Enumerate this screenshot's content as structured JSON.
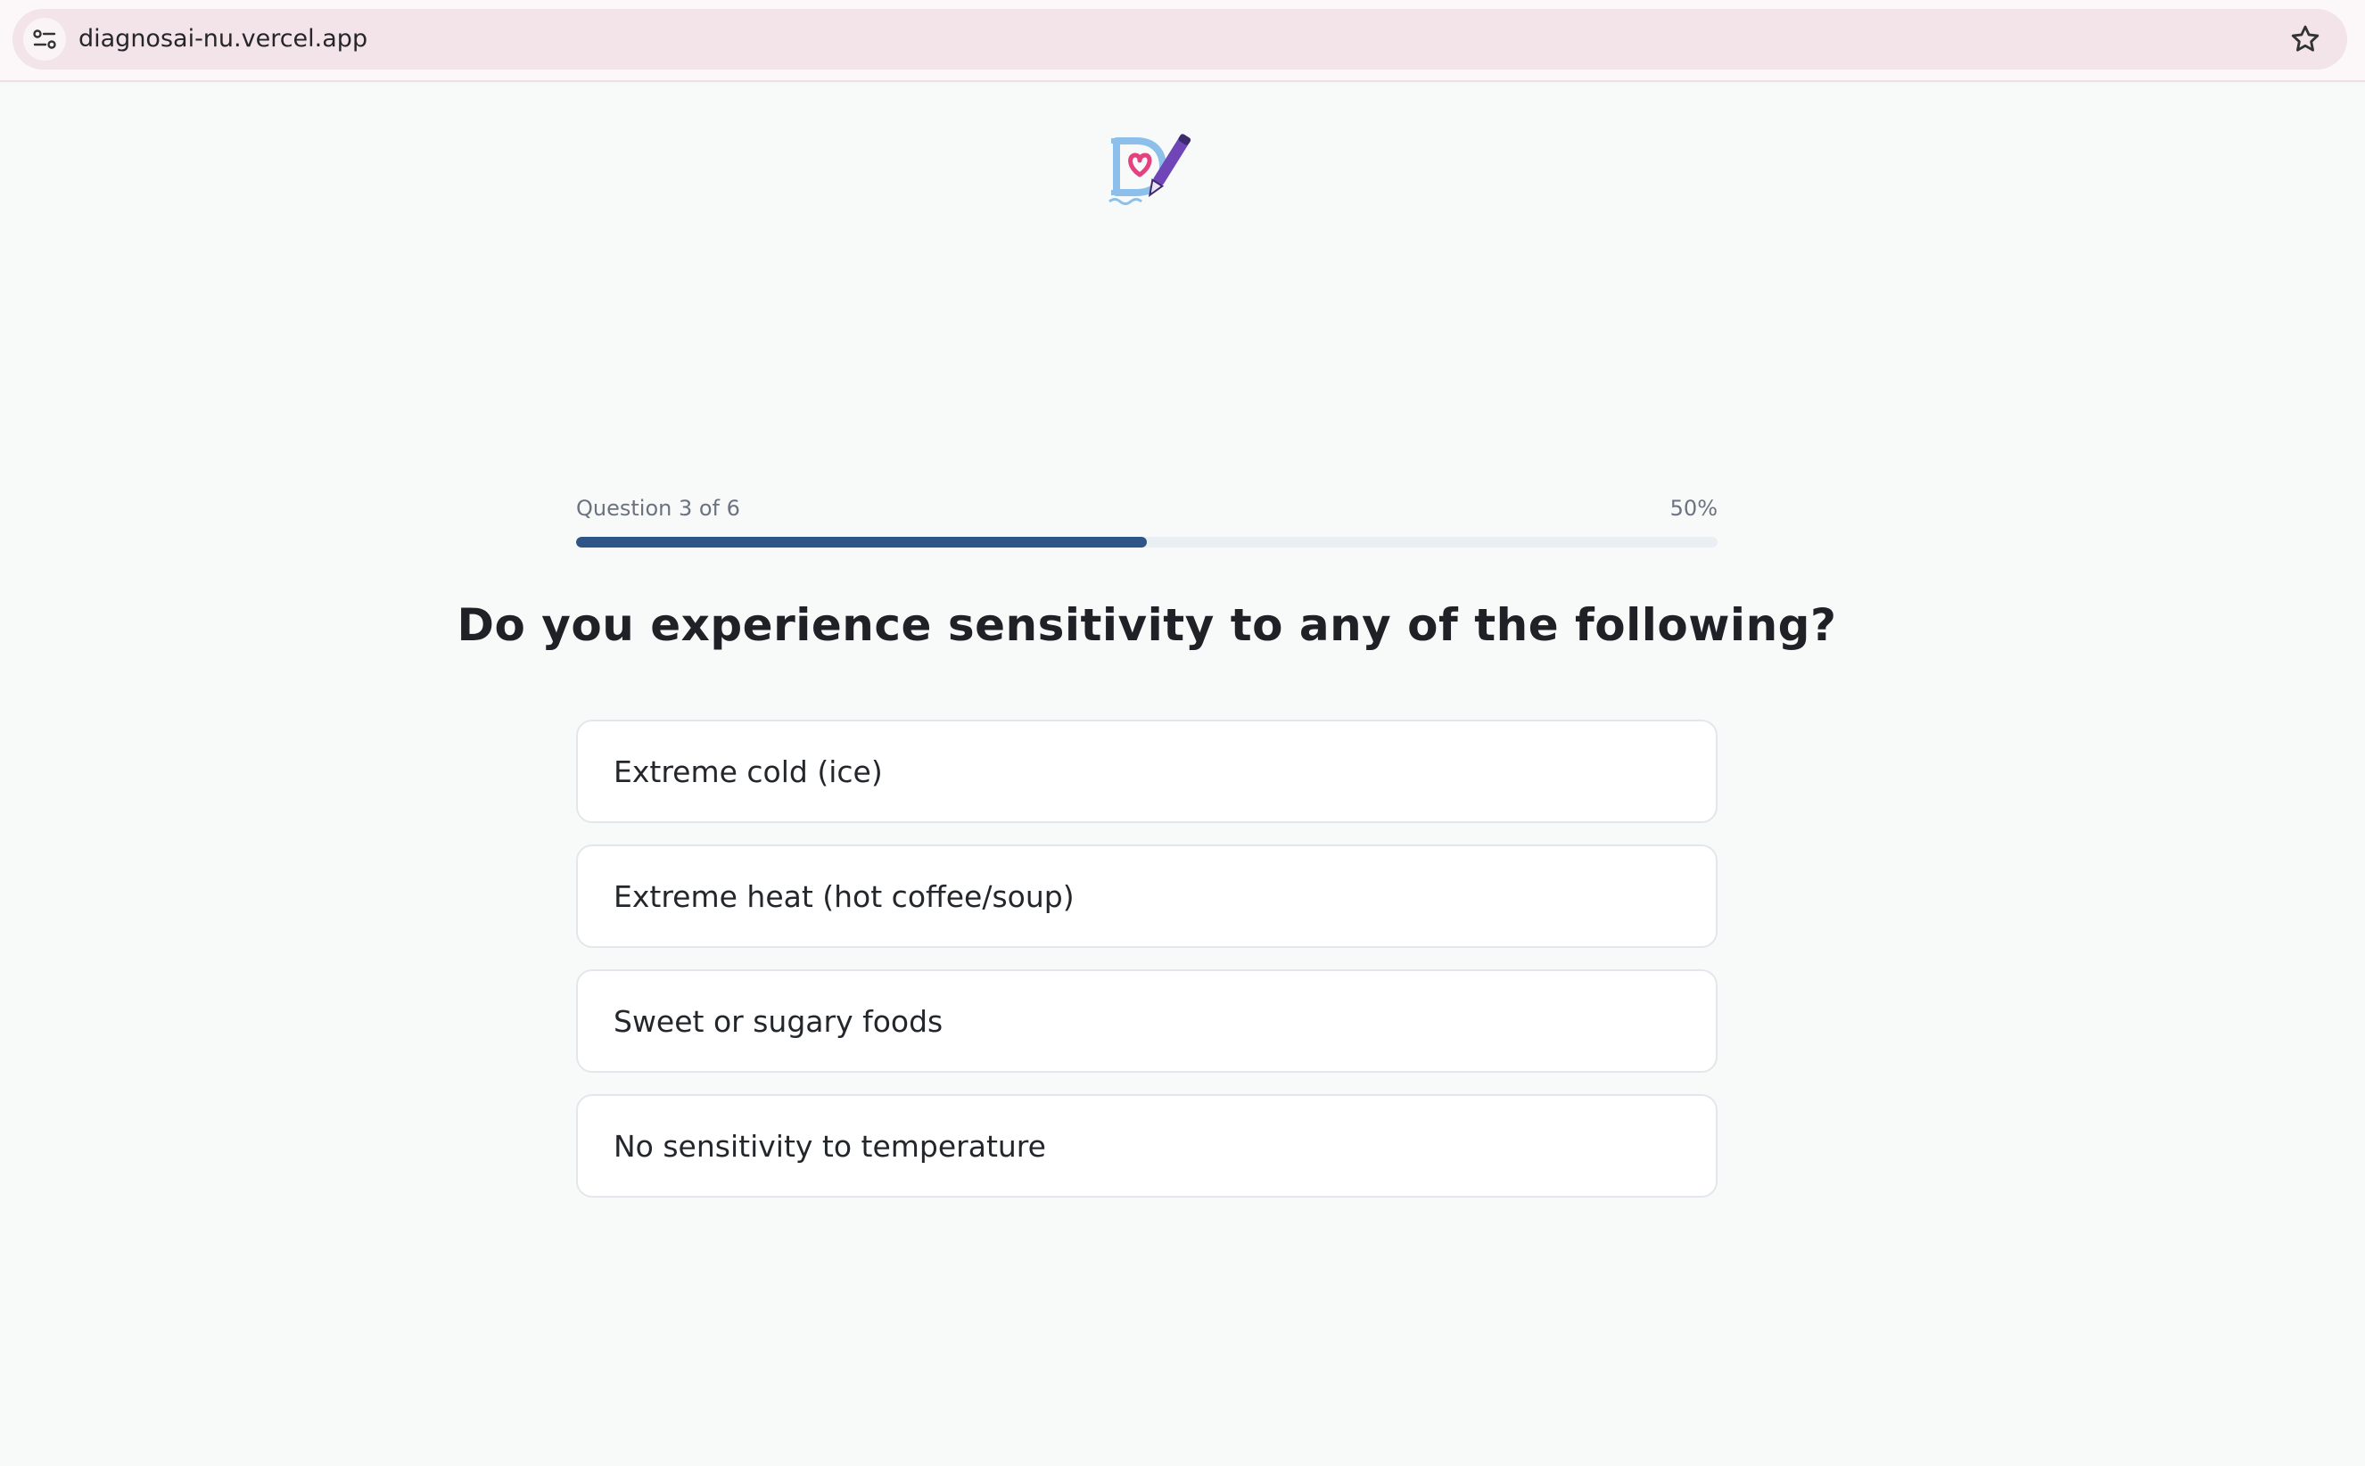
{
  "browser": {
    "url": "diagnosai-nu.vercel.app"
  },
  "quiz": {
    "question_counter": "Question 3 of 6",
    "progress_label": "50%",
    "progress_fraction": 0.5,
    "question": "Do you experience sensitivity to any of the following?",
    "options": [
      "Extreme cold (ice)",
      "Extreme heat (hot coffee/soup)",
      "Sweet or sugary foods",
      "No sensitivity to temperature"
    ]
  },
  "colors": {
    "accent": "#2f5586",
    "logo_blue": "#8cc0ea",
    "logo_pink": "#e4427e",
    "logo_purple": "#6f45b8"
  }
}
